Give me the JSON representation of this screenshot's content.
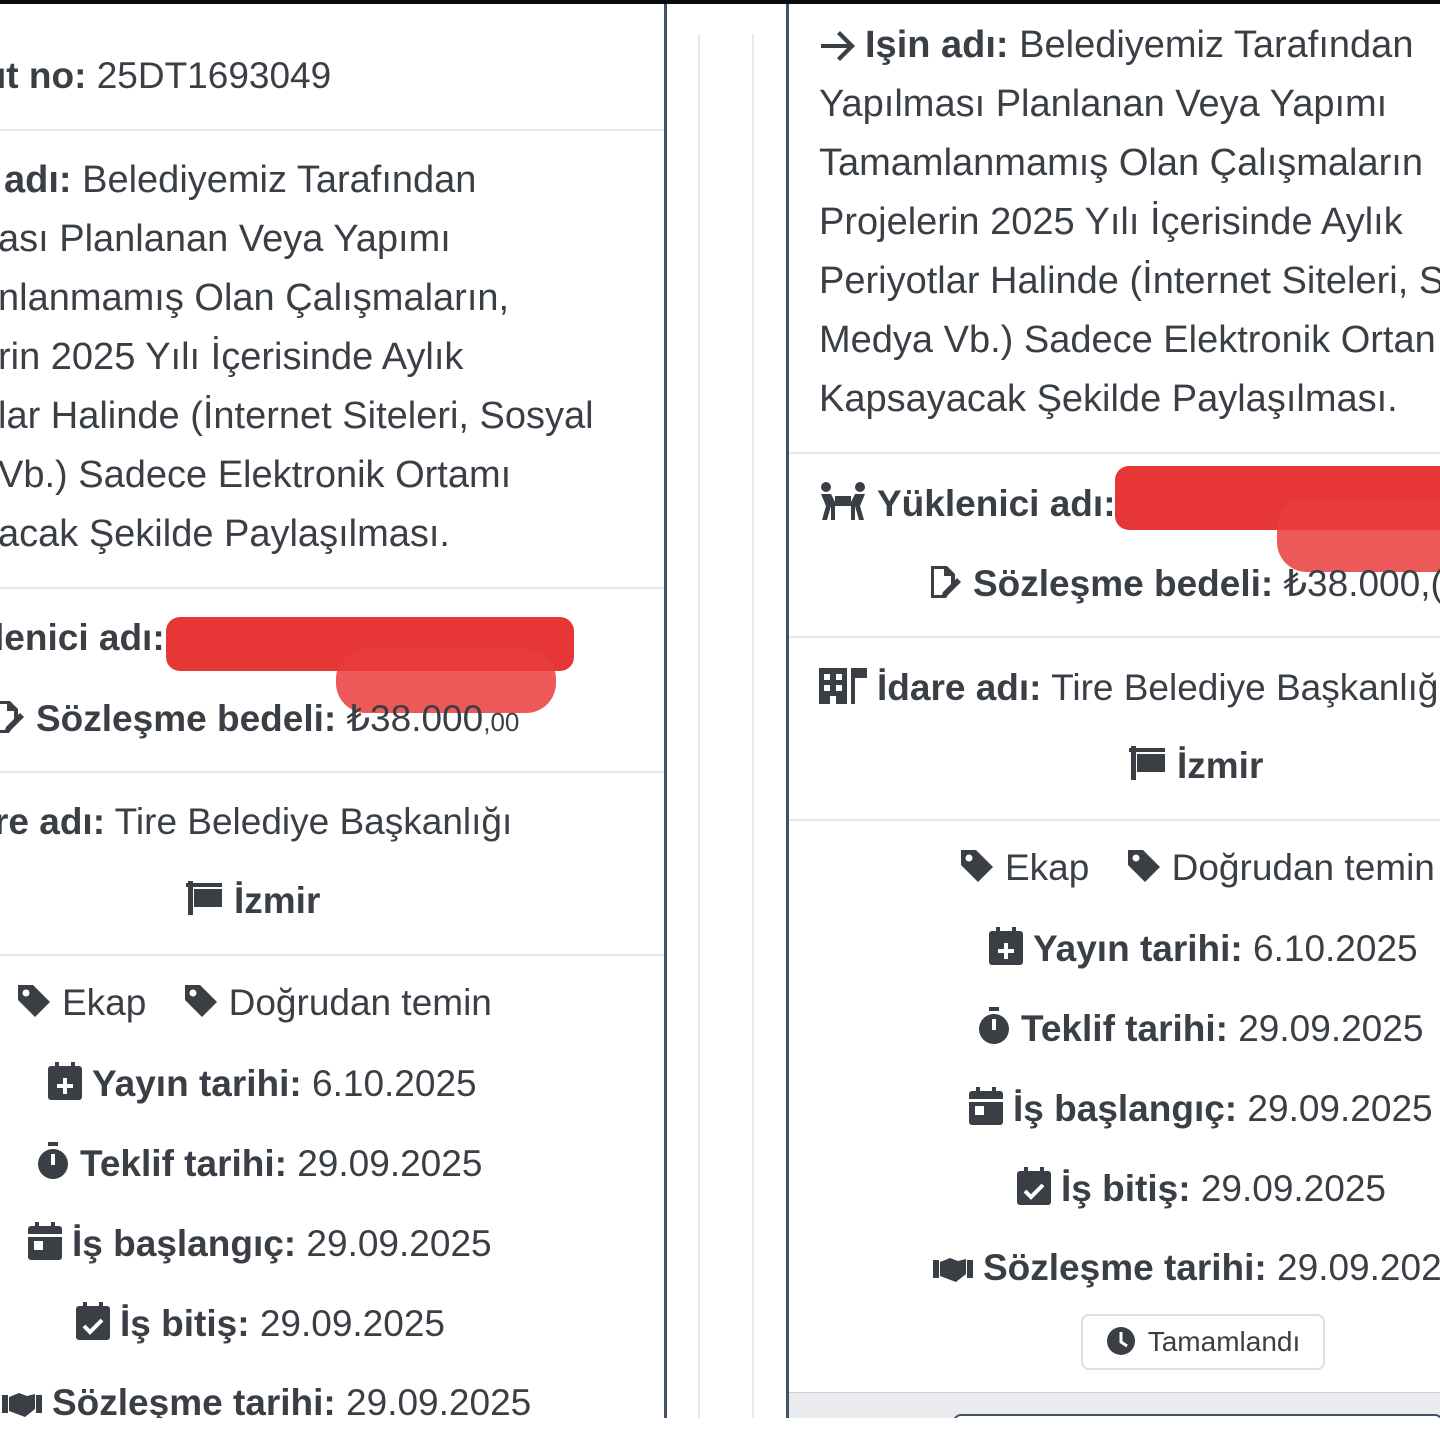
{
  "left_card": {
    "kayit_no": {
      "label": "ıt no:",
      "value": "25DT1693049"
    },
    "is_adi": {
      "label": "adı:",
      "line1": "Belediyemiz Tarafından",
      "line2": "ası Planlanan Veya Yapımı",
      "line3": "nlanmamış Olan Çalışmaların,",
      "line4": "rin 2025 Yılı İçerisinde Aylık",
      "line5": "lar Halinde (İnternet Siteleri, Sosyal",
      "line6": "Vb.) Sadece Elektronik Ortamı",
      "line7": "acak Şekilde Paylaşılması."
    },
    "yuklenici": {
      "label": "lenici adı:"
    },
    "sozlesme_bedeli": {
      "label": "Sözleşme bedeli:",
      "value": "₺38.000",
      "decimals": ",00"
    },
    "idare": {
      "label": "re adı:",
      "value": "Tire Belediye Başkanlığı"
    },
    "il": "İzmir",
    "tags": [
      "Ekap",
      "Doğrudan temin"
    ],
    "yayin": {
      "label": "Yayın tarihi:",
      "value": "6.10.2025"
    },
    "teklif": {
      "label": "Teklif tarihi:",
      "value": "29.09.2025"
    },
    "baslangic": {
      "label": "İş başlangıç:",
      "value": "29.09.2025"
    },
    "bitis": {
      "label": "İş bitiş:",
      "value": "29.09.2025"
    },
    "sozlesme_tarihi": {
      "label": "Sözleşme tarihi:",
      "value": "29.09.2025"
    }
  },
  "right_card": {
    "is_adi": {
      "label": "Işin adı:",
      "line1": "Belediyemiz Tarafından",
      "line2": "Yapılması Planlanan Veya Yapımı",
      "line3": "Tamamlanmamış Olan Çalışmaların",
      "line4": "Projelerin 2025 Yılı İçerisinde Aylık",
      "line5": "Periyotlar Halinde (İnternet Siteleri, S",
      "line6": "Medya Vb.) Sadece Elektronik Ortan",
      "line7": "Kapsayacak Şekilde Paylaşılması."
    },
    "yuklenici": {
      "label": "Yüklenici adı:"
    },
    "sozlesme_bedeli": {
      "label": "Sözleşme bedeli:",
      "value": "₺38.000,("
    },
    "idare": {
      "label": "İdare adı:",
      "value": "Tire Belediye Başkanlığ"
    },
    "il": "İzmir",
    "tags": [
      "Ekap",
      "Doğrudan temin"
    ],
    "yayin": {
      "label": "Yayın tarihi:",
      "value": "6.10.2025"
    },
    "teklif": {
      "label": "Teklif tarihi:",
      "value": "29.09.2025"
    },
    "baslangic": {
      "label": "İş başlangıç:",
      "value": "29.09.2025"
    },
    "bitis": {
      "label": "İş bitiş:",
      "value": "29.09.2025"
    },
    "sozlesme_tarihi": {
      "label": "Sözleşme tarihi:",
      "value": "29.09.202"
    },
    "status_button": "Tamamlandı"
  },
  "icons": {
    "arrow": "arrow-right-icon",
    "contractor": "people-carry-icon",
    "contract": "file-signature-icon",
    "building": "building-flag-icon",
    "flag": "flag-icon",
    "tag": "tag-icon",
    "calendar_plus": "calendar-plus-icon",
    "stopwatch": "stopwatch-icon",
    "calendar_day": "calendar-day-icon",
    "calendar_check": "calendar-check-icon",
    "handshake": "handshake-icon",
    "clock": "clock-icon"
  },
  "colors": {
    "text": "#3a3f46",
    "redaction": "#e52b2b",
    "border": "#3f5266"
  }
}
